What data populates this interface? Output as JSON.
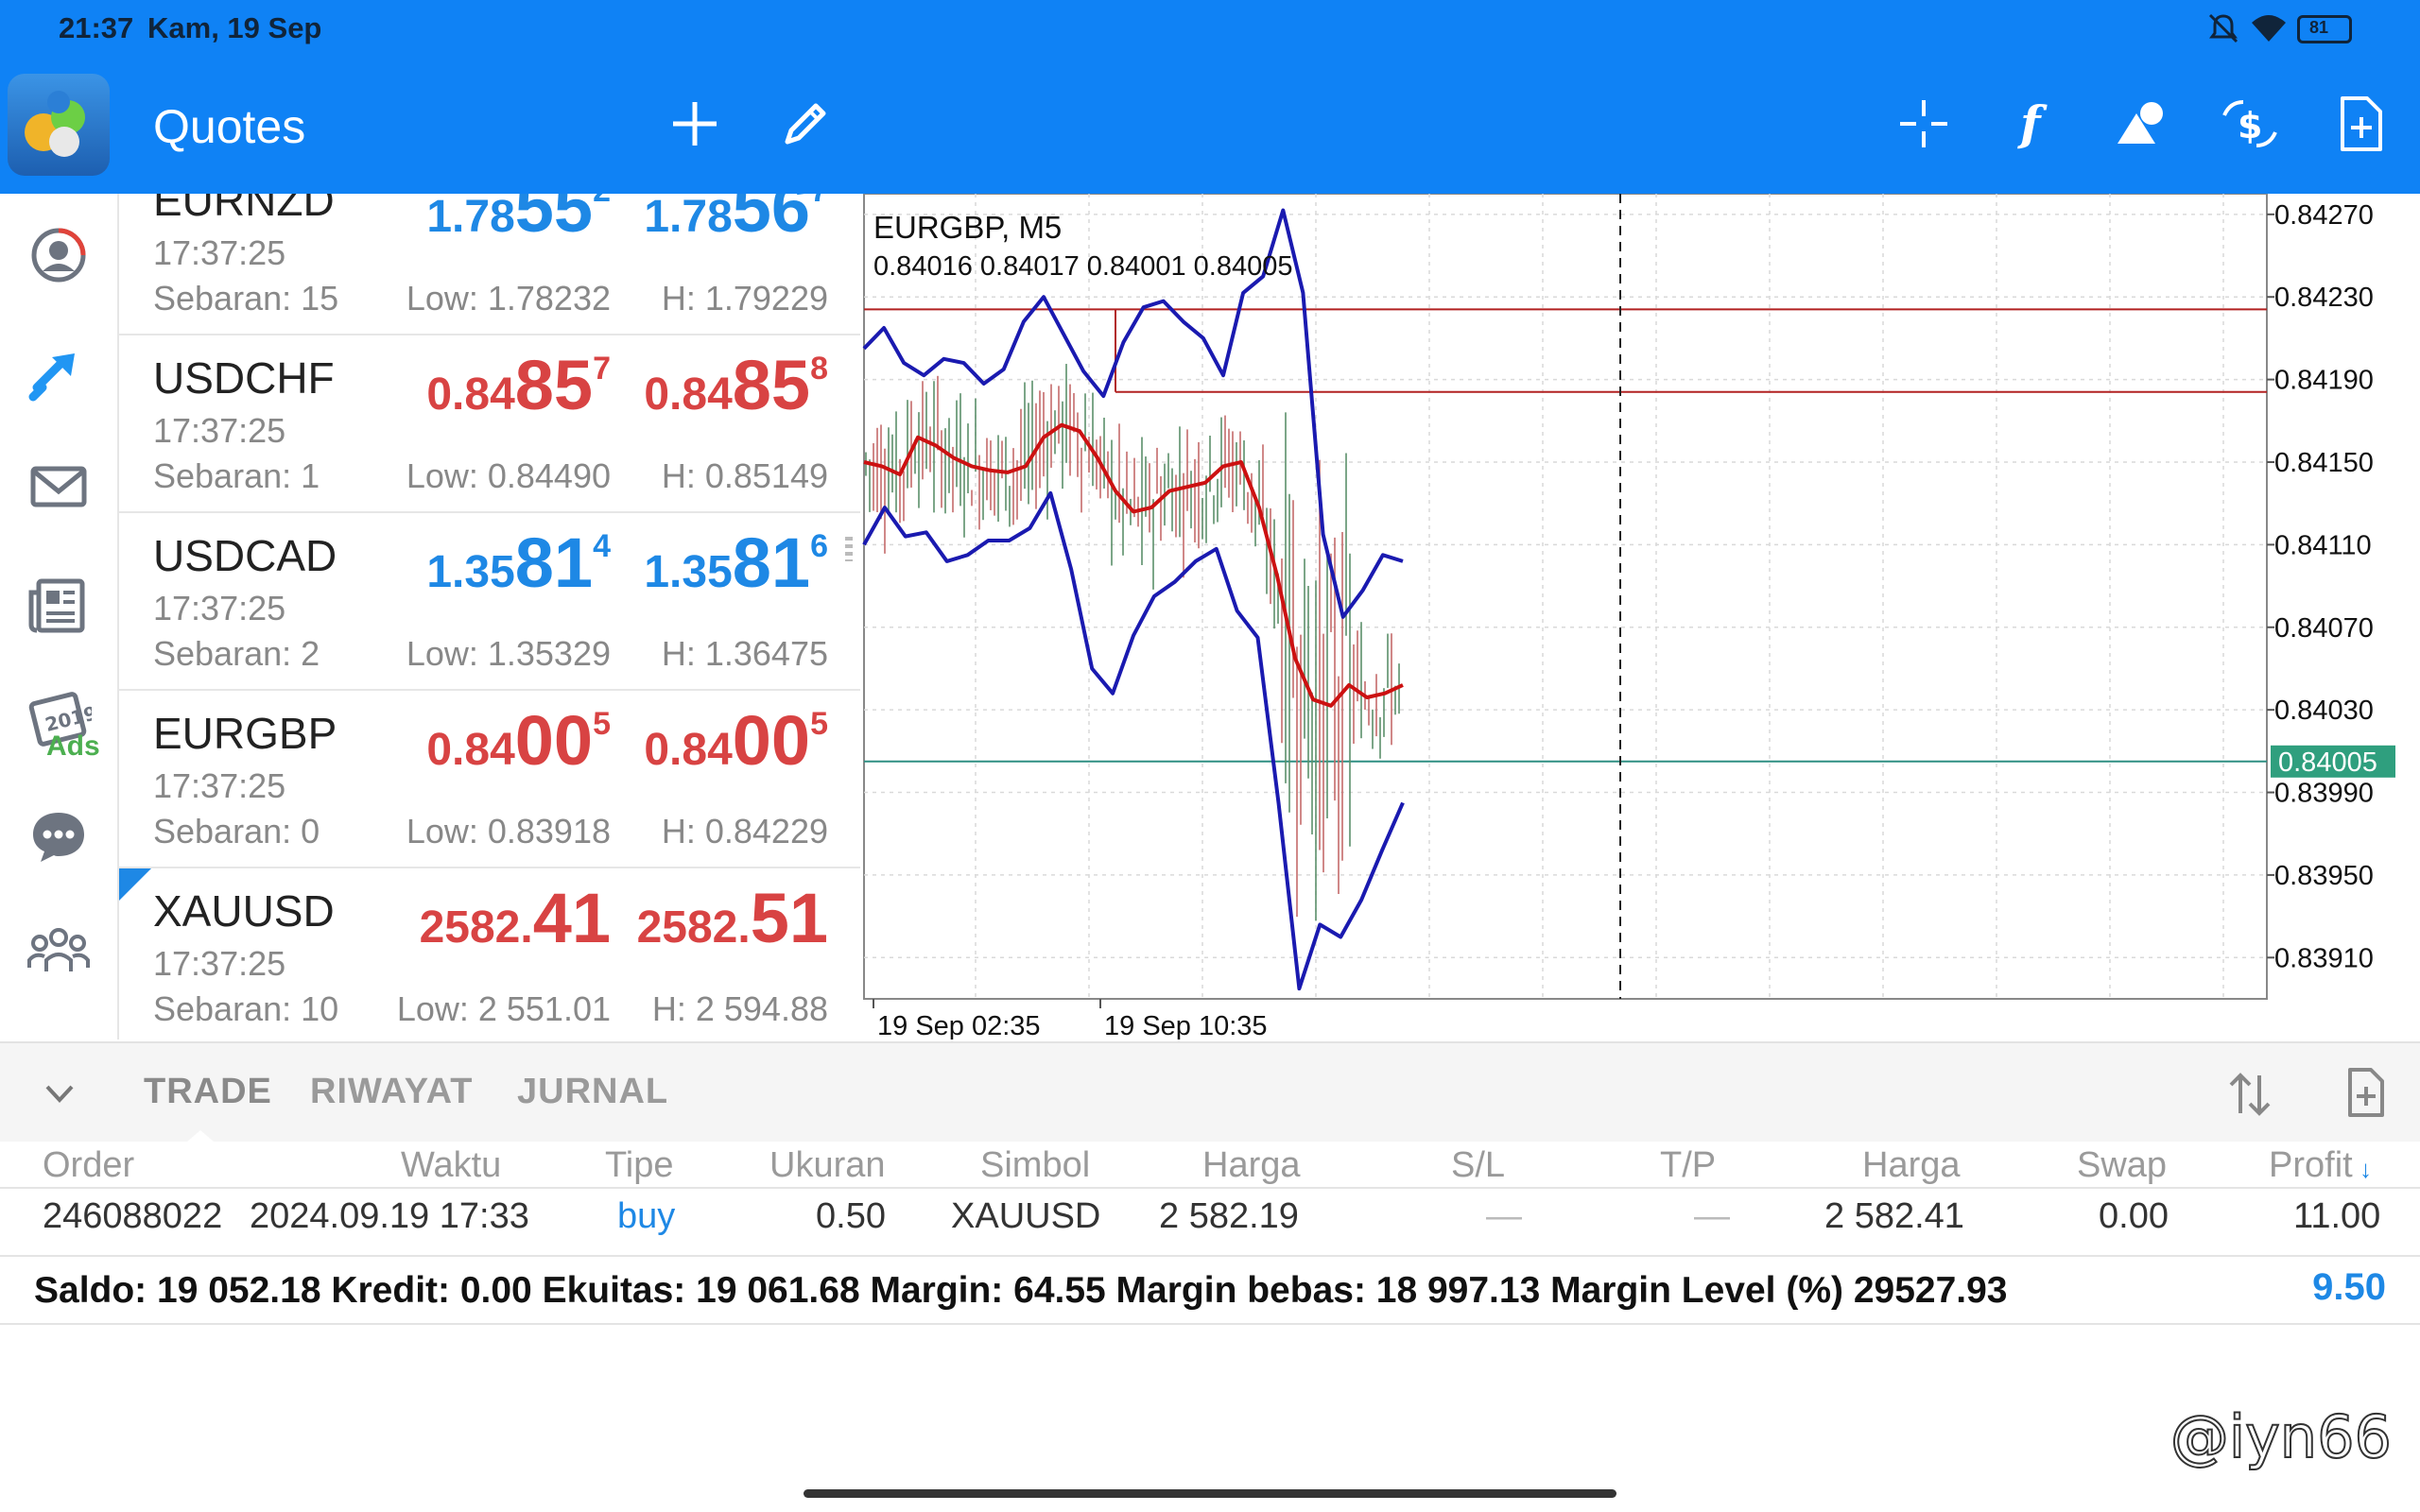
{
  "status_bar": {
    "time": "21:37",
    "date": "Kam, 19 Sep",
    "battery": "81"
  },
  "app_bar": {
    "title": "Quotes"
  },
  "quotes": [
    {
      "symbol": "EURNZD",
      "time": "17:37:25",
      "spread": "Sebaran: 15",
      "bid": {
        "a": "1.78",
        "b": "55",
        "c": "2"
      },
      "ask": {
        "a": "1.78",
        "b": "56",
        "c": "7"
      },
      "low": "Low: 1.78232",
      "high": "H: 1.79229",
      "color": "blue"
    },
    {
      "symbol": "USDCHF",
      "time": "17:37:25",
      "spread": "Sebaran: 1",
      "bid": {
        "a": "0.84",
        "b": "85",
        "c": "7"
      },
      "ask": {
        "a": "0.84",
        "b": "85",
        "c": "8"
      },
      "low": "Low: 0.84490",
      "high": "H: 0.85149",
      "color": "red"
    },
    {
      "symbol": "USDCAD",
      "time": "17:37:25",
      "spread": "Sebaran: 2",
      "bid": {
        "a": "1.35",
        "b": "81",
        "c": "4"
      },
      "ask": {
        "a": "1.35",
        "b": "81",
        "c": "6"
      },
      "low": "Low: 1.35329",
      "high": "H: 1.36475",
      "color": "blue"
    },
    {
      "symbol": "EURGBP",
      "time": "17:37:25",
      "spread": "Sebaran: 0",
      "bid": {
        "a": "0.84",
        "b": "00",
        "c": "5"
      },
      "ask": {
        "a": "0.84",
        "b": "00",
        "c": "5"
      },
      "low": "Low: 0.83918",
      "high": "H: 0.84229",
      "color": "red"
    },
    {
      "symbol": "XAUUSD",
      "time": "17:37:25",
      "spread": "Sebaran: 10",
      "bid": {
        "a": "2582.",
        "b": "41",
        "c": ""
      },
      "ask": {
        "a": "2582.",
        "b": "51",
        "c": ""
      },
      "low": "Low: 2 551.01",
      "high": "H: 2 594.88",
      "color": "red"
    }
  ],
  "chart": {
    "title": "EURGBP, M5",
    "ohlc": "0.84016 0.84017 0.84001 0.84005",
    "y_ticks": [
      "0.84270",
      "0.84230",
      "0.84190",
      "0.84150",
      "0.84110",
      "0.84070",
      "0.84030",
      "0.83990",
      "0.83950",
      "0.83910"
    ],
    "current_price": "0.84005",
    "x_ticks": [
      "19 Sep 02:35",
      "19 Sep 10:35"
    ],
    "colors": {
      "bands": "#1a1ab0",
      "ma": "#cc1111",
      "level": "#b22222",
      "price_line": "#2f8f82"
    }
  },
  "chart_data": {
    "type": "line",
    "title": "EURGBP, M5",
    "ylim": [
      0.8389,
      0.8428
    ],
    "y_ticks": [
      0.8427,
      0.8423,
      0.8419,
      0.8415,
      0.8411,
      0.8407,
      0.8403,
      0.8399,
      0.8395,
      0.8391
    ],
    "x_tick_labels": [
      "19 Sep 02:35",
      "19 Sep 10:35"
    ],
    "horizontal_levels": [
      0.84224,
      0.84184
    ],
    "current_price": 0.84005,
    "series": [
      {
        "values": [
          0.8415,
          0.84148,
          0.84144,
          0.84162,
          0.84158,
          0.84152,
          0.84148,
          0.84146,
          0.84145,
          0.84148,
          0.84162,
          0.84168,
          0.84165,
          0.84152,
          0.84136,
          0.84126,
          0.84128,
          0.84136,
          0.84138,
          0.8414,
          0.84148,
          0.8415,
          0.84128,
          0.84095,
          0.84055,
          0.84035,
          0.84032,
          0.84042,
          0.84036,
          0.84038,
          0.84042
        ]
      },
      {
        "values": [
          0.84205,
          0.84215,
          0.84198,
          0.84192,
          0.842,
          0.84198,
          0.84188,
          0.84195,
          0.84218,
          0.8423,
          0.84212,
          0.84194,
          0.84182,
          0.84208,
          0.84225,
          0.84228,
          0.84218,
          0.8421,
          0.84192,
          0.84232,
          0.8424,
          0.84272,
          0.84232,
          0.84115,
          0.84075,
          0.84088,
          0.84105,
          0.84102
        ]
      },
      {
        "values": [
          0.8411,
          0.84128,
          0.84114,
          0.84116,
          0.84102,
          0.84105,
          0.84112,
          0.84112,
          0.84118,
          0.84135,
          0.84098,
          0.8405,
          0.84038,
          0.84066,
          0.84085,
          0.84092,
          0.84102,
          0.84108,
          0.84078,
          0.84065,
          0.83985,
          0.83895,
          0.83926,
          0.8392,
          0.83938,
          0.83962,
          0.83985
        ]
      }
    ]
  },
  "bottom_tabs": [
    "TRADE",
    "RIWAYAT",
    "JURNAL"
  ],
  "table": {
    "headers": [
      "Order",
      "Waktu",
      "Tipe",
      "Ukuran",
      "Simbol",
      "Harga",
      "S/L",
      "T/P",
      "Harga",
      "Swap",
      "Profit"
    ],
    "rows": [
      [
        "246088022",
        "2024.09.19 17:33",
        "buy",
        "0.50",
        "XAUUSD",
        "2 582.19",
        "—",
        "—",
        "2 582.41",
        "0.00",
        "11.00"
      ]
    ]
  },
  "summary": {
    "text": "Saldo: 19 052.18  Kredit: 0.00  Ekuitas: 19 061.68  Margin: 64.55  Margin bebas: 18 997.13  Margin Level (%)  29527.93",
    "profit": "9.50"
  },
  "watermark": "@iyn66"
}
